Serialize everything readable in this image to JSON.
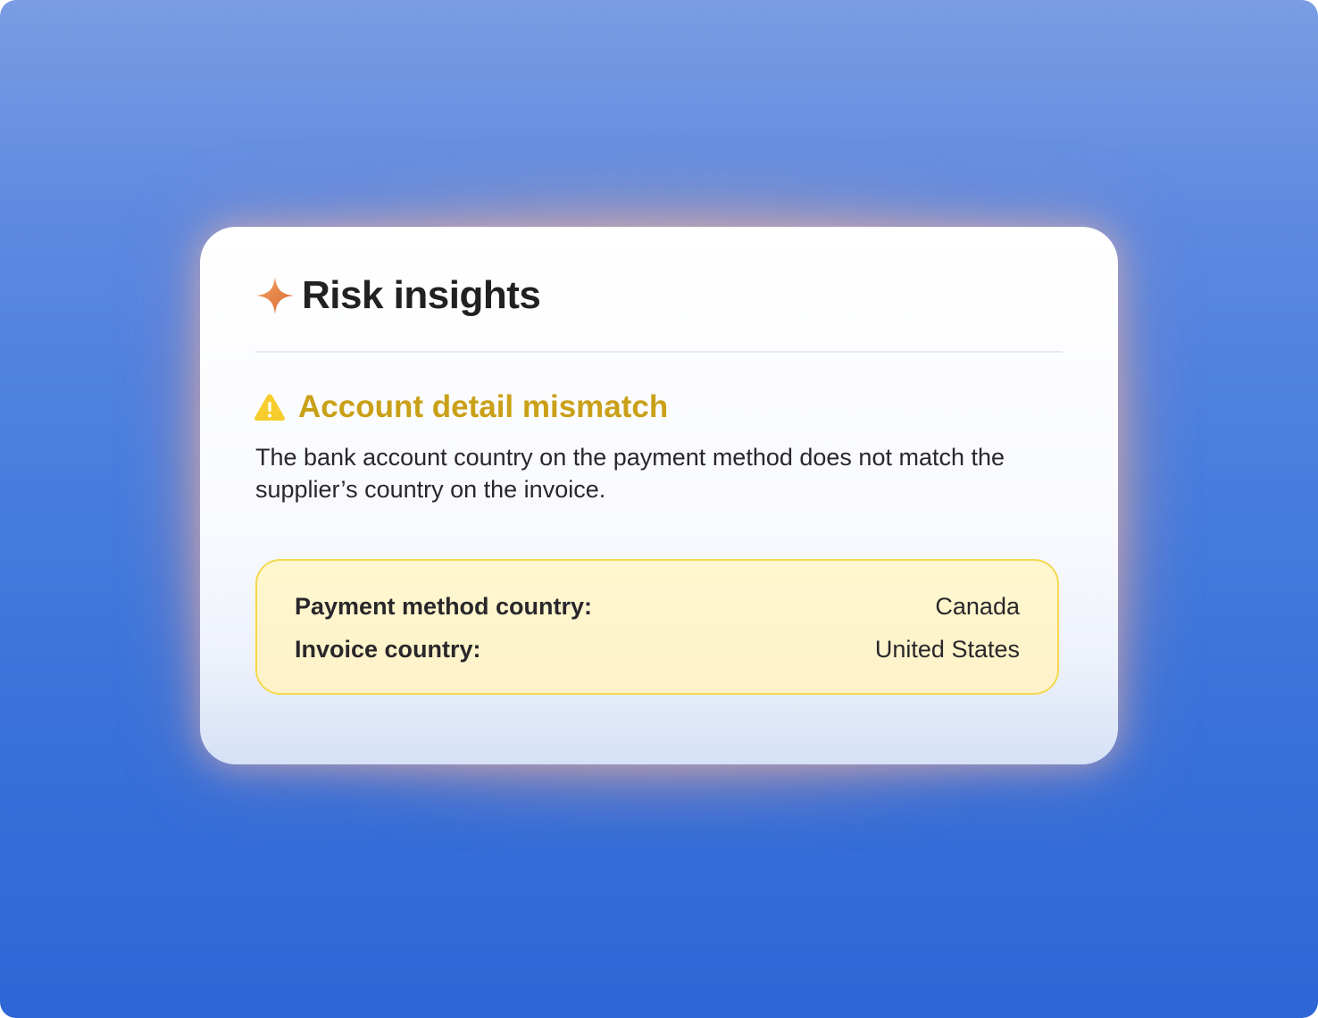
{
  "card": {
    "title": "Risk insights",
    "icon": "sparkle-icon",
    "icon_color": "#e2763a"
  },
  "alert": {
    "icon": "warning-icon",
    "color": "#c9a018",
    "title": "Account detail mismatch",
    "description": "The bank account country on the payment method does not match the supplier’s country on the invoice."
  },
  "details": {
    "rows": [
      {
        "label": "Payment method country:",
        "value": "Canada"
      },
      {
        "label": "Invoice country:",
        "value": "United States"
      }
    ]
  }
}
